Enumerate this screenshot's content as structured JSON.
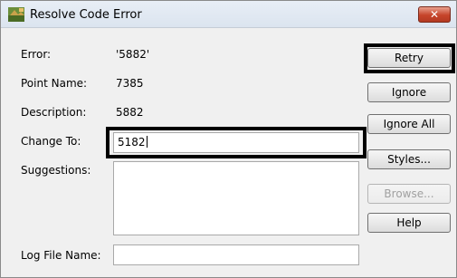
{
  "window": {
    "title": "Resolve Code Error",
    "close_label": "✕"
  },
  "fields": {
    "error_label": "Error:",
    "error_value": "'5882'",
    "point_name_label": "Point Name:",
    "point_name_value": "7385",
    "description_label": "Description:",
    "description_value": "5882",
    "change_to_label": "Change To:",
    "change_to_value": "5182",
    "suggestions_label": "Suggestions:",
    "log_file_label": "Log File Name:",
    "log_file_value": ""
  },
  "buttons": {
    "retry": "Retry",
    "ignore": "Ignore",
    "ignore_all": "Ignore All",
    "styles": "Styles...",
    "browse": "Browse...",
    "help": "Help"
  },
  "colors": {
    "dialog_background": "#f0f0f0",
    "close_button": "#c6442a",
    "highlight_box": "#000000"
  },
  "icons": {
    "app": "resolve-code-app-icon",
    "close": "close-icon"
  }
}
